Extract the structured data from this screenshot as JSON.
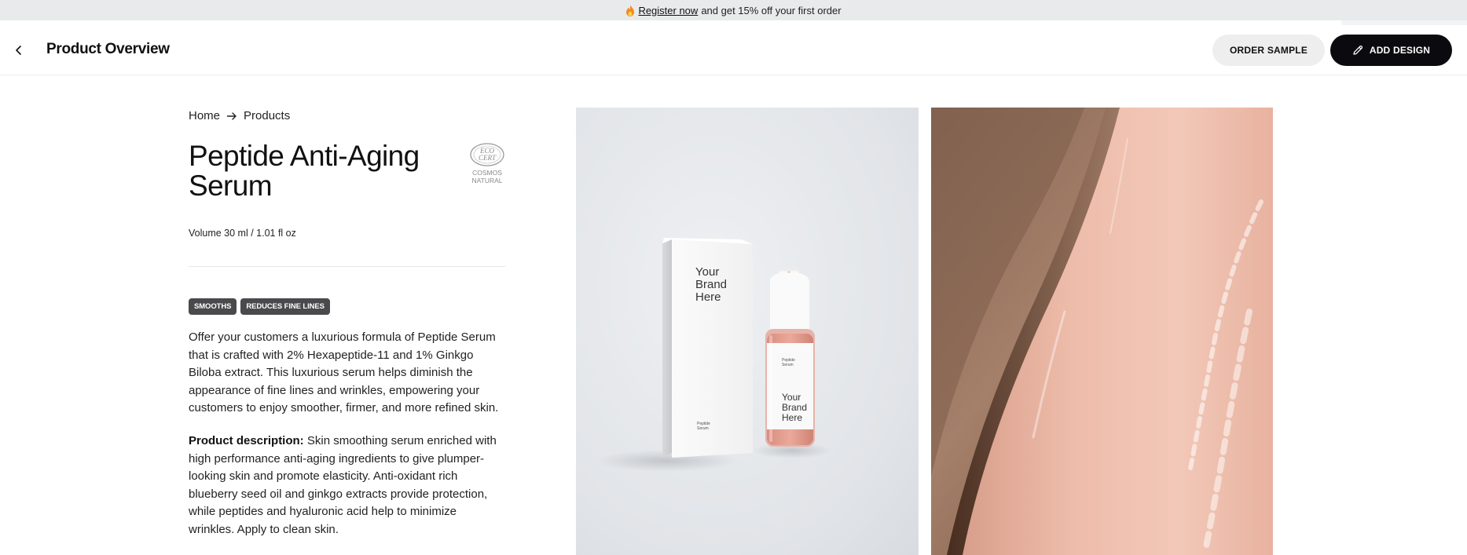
{
  "promo": {
    "link_text": "Register now",
    "text": "and get 15% off your first order"
  },
  "header": {
    "title": "Product Overview",
    "order_sample_label": "ORDER SAMPLE",
    "add_design_label": "ADD DESIGN"
  },
  "breadcrumb": {
    "home": "Home",
    "products": "Products"
  },
  "product": {
    "title": "Peptide Anti-Aging Serum",
    "certification": {
      "logo_text": "ECO CERT",
      "line1": "COSMOS",
      "line2": "NATURAL"
    },
    "volume": "Volume 30 ml / 1.01 fl oz",
    "tags": [
      "SMOOTHS",
      "REDUCES FINE LINES"
    ],
    "summary": "Offer your customers a luxurious formula of Peptide Serum that is crafted with 2% Hexapeptide-11 and 1% Ginkgo Biloba extract. This luxurious serum helps diminish the appearance of fine lines and wrinkles, empowering your customers to enjoy smoother, firmer, and more refined skin.",
    "description_label": "Product description:",
    "description": "Skin smoothing serum enriched with high performance anti-aging ingredients to give plumper-looking skin and promote elasticity. Anti-oxidant rich blueberry seed oil and ginkgo extracts provide protection, while peptides and hyaluronic acid help to minimize wrinkles. Apply to clean skin."
  },
  "images": {
    "packaging": {
      "box_text": [
        "Your",
        "Brand",
        "Here"
      ],
      "box_small_text": [
        "Peptide",
        "Serum"
      ],
      "bottle_text": [
        "Your",
        "Brand",
        "Here"
      ],
      "bottle_small_text": [
        "Peptide",
        "Serum"
      ]
    }
  },
  "colors": {
    "promo_bg": "#e9eaec",
    "primary_button": "#0b0b0f",
    "secondary_button": "#eeeeef",
    "tag_bg": "#4a4a4d"
  }
}
